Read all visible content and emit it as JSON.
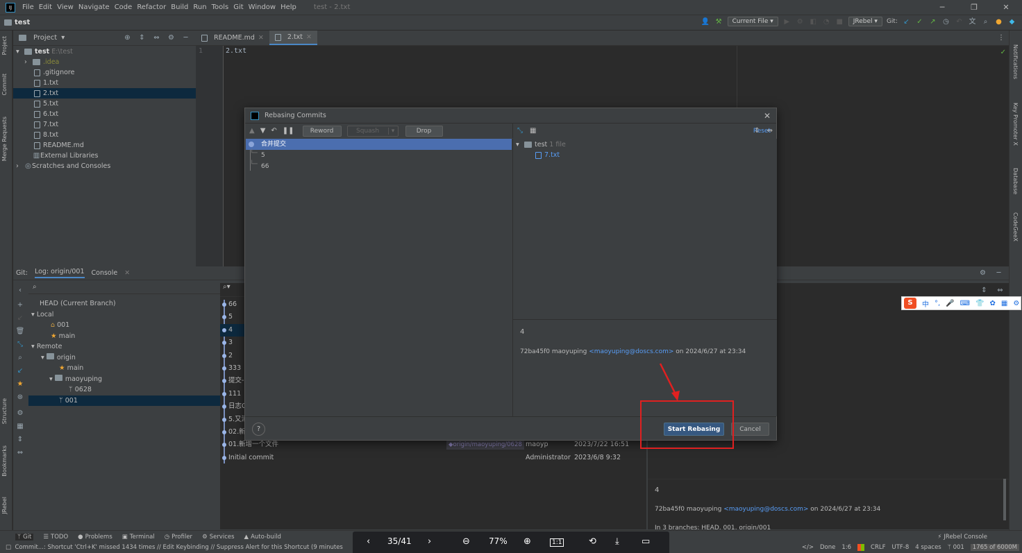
{
  "menubar": {
    "items": [
      "File",
      "Edit",
      "View",
      "Navigate",
      "Code",
      "Refactor",
      "Build",
      "Run",
      "Tools",
      "Git",
      "Window",
      "Help"
    ],
    "window_title": "test - 2.txt"
  },
  "navbar": {
    "project": "test",
    "run_config": "Current File",
    "jrebel": "JRebel",
    "git_label": "Git:"
  },
  "left_stripe": {
    "project": "Project",
    "commit": "Commit",
    "merge_requests": "Merge Requests",
    "structure": "Structure",
    "bookmarks": "Bookmarks",
    "jrebel": "JRebel"
  },
  "right_stripe": {
    "notifications": "Notifications",
    "key_promoter": "Key Promoter X",
    "database": "Database",
    "codegeex": "CodeGeeX"
  },
  "project_panel": {
    "title": "Project",
    "root": "test",
    "root_path": "E:\\test",
    "items": [
      ".idea",
      ".gitignore",
      "1.txt",
      "2.txt",
      "5.txt",
      "6.txt",
      "7.txt",
      "8.txt",
      "README.md"
    ],
    "external": "External Libraries",
    "scratches": "Scratches and Consoles"
  },
  "editor": {
    "tabs": [
      "README.md",
      "2.txt"
    ],
    "line_number": "1",
    "content": "2.txt"
  },
  "bottom": {
    "git_label": "Git:",
    "tabs": [
      "Log: origin/001",
      "Console"
    ],
    "branches": {
      "head": "HEAD (Current Branch)",
      "local": "Local",
      "local_001": "001",
      "local_main": "main",
      "remote": "Remote",
      "origin": "origin",
      "origin_main": "main",
      "maoyuping": "maoyuping",
      "b0628": "0628",
      "b001": "001"
    },
    "log": [
      {
        "msg": "66",
        "author": "",
        "date": ""
      },
      {
        "msg": "5",
        "author": "",
        "date": ""
      },
      {
        "msg": "4",
        "author": "",
        "date": ""
      },
      {
        "msg": "3",
        "author": "",
        "date": ""
      },
      {
        "msg": "2",
        "author": "",
        "date": ""
      },
      {
        "msg": "333",
        "author": "",
        "date": ""
      },
      {
        "msg": "提交-",
        "author": "",
        "date": ""
      },
      {
        "msg": "111",
        "author": "",
        "date": ""
      },
      {
        "msg": "日志C",
        "author": "",
        "date": ""
      },
      {
        "msg": "5.又添",
        "author": "",
        "date": ""
      },
      {
        "msg": "02.新",
        "author": "",
        "date": ""
      },
      {
        "msg": "01.新增一个文件",
        "author": "maoyp",
        "date": "2023/7/22 16:51"
      },
      {
        "msg": "Initial commit",
        "author": "Administrator",
        "date": "2023/6/8 9:32"
      }
    ],
    "ref_tag": "origin/maoyuping/0628",
    "detail_title": "4",
    "detail_hash_author": "72ba45f0 maoyuping",
    "detail_email": "<maoyuping@doscs.com>",
    "detail_date": "on 2024/6/27 at 23:34",
    "detail_branches": "In 3 branches: HEAD, 001, origin/001"
  },
  "dialog": {
    "title": "Rebasing Commits",
    "reword": "Reword",
    "squash": "Squash",
    "drop": "Drop",
    "reset": "Reset",
    "commits": [
      "合并提交",
      "5",
      "66"
    ],
    "changes_root": "test",
    "changes_count": "1 file",
    "changed_file": "7.txt",
    "detail_title": "4",
    "detail_hash_author": "72ba45f0 maoyuping",
    "detail_email": "<maoyuping@doscs.com>",
    "detail_date": "on 2024/6/27 at 23:34",
    "help": "?",
    "start": "Start Rebasing",
    "cancel": "Cancel"
  },
  "sogou": {
    "label": "中"
  },
  "statusbar": {
    "tabs": [
      "Git",
      "TODO",
      "Problems",
      "Terminal",
      "Profiler",
      "Services",
      "Auto-build"
    ],
    "jrebel_console": "JRebel Console",
    "message": "Commit...: Shortcut 'Ctrl+K' missed 1434 times // Edit Keybinding // Suppress Alert for this Shortcut (9 minutes",
    "done": "Done",
    "position": "1:6",
    "line_sep": "CRLF",
    "encoding": "UTF-8",
    "indent": "4 spaces",
    "branch": "001",
    "memory": "1765 of 6000M"
  },
  "viewer": {
    "page": "35/41",
    "zoom": "77%"
  }
}
